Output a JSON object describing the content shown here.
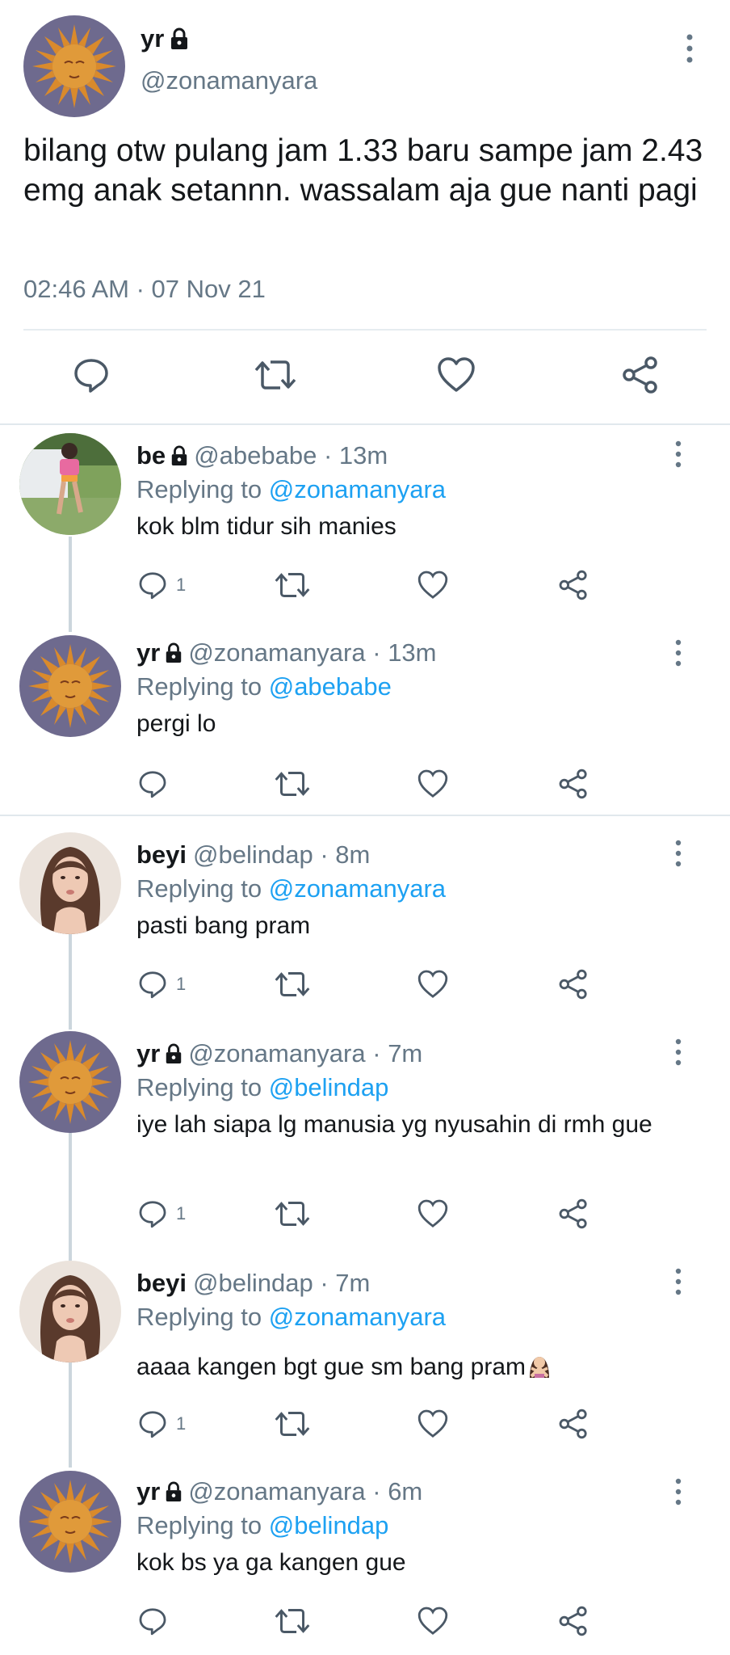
{
  "colors": {
    "accent": "#1da1f2",
    "text": "#14171a",
    "secondary": "#657786",
    "icon": "#4a5866",
    "divider": "#e1e8ed"
  },
  "main_tweet": {
    "name": "yr",
    "handle": "@zonamanyara",
    "text": "bilang otw pulang jam 1.33 baru sampe jam 2.43 emg anak setannn. wassalam aja gue nanti pagi",
    "timestamp": "02:46 AM · 07 Nov 21",
    "avatar": "sun-avatar",
    "locked": true
  },
  "replies": [
    {
      "name": "be",
      "locked": true,
      "handle": "@abebabe",
      "time": "13m",
      "replying_prefix": "Replying to ",
      "replying_to": "@zonamanyara",
      "text": "kok blm tidur sih manies",
      "reply_count": "1",
      "avatar": "photo-avatar-pink-shirt"
    },
    {
      "name": "yr",
      "locked": true,
      "handle": "@zonamanyara",
      "time": "13m",
      "replying_prefix": "Replying to ",
      "replying_to": "@abebabe",
      "text": "pergi lo",
      "reply_count": "",
      "avatar": "sun-avatar"
    },
    {
      "name": "beyi",
      "locked": false,
      "handle": "@belindap",
      "time": "8m",
      "replying_prefix": "Replying to ",
      "replying_to": "@zonamanyara",
      "text": "pasti bang pram",
      "reply_count": "1",
      "avatar": "photo-avatar-woman"
    },
    {
      "name": "yr",
      "locked": true,
      "handle": "@zonamanyara",
      "time": "7m",
      "replying_prefix": "Replying to ",
      "replying_to": "@belindap",
      "text": "iye lah siapa lg manusia yg nyusahin di rmh gue",
      "reply_count": "1",
      "avatar": "sun-avatar"
    },
    {
      "name": "beyi",
      "locked": false,
      "handle": "@belindap",
      "time": "7m",
      "replying_prefix": "Replying to ",
      "replying_to": "@zonamanyara",
      "text": "aaaa kangen bgt gue sm bang pram",
      "reply_count": "1",
      "avatar": "photo-avatar-woman",
      "emoji": "person-gesturing-no-emoji"
    },
    {
      "name": "yr",
      "locked": true,
      "handle": "@zonamanyara",
      "time": "6m",
      "replying_prefix": "Replying to ",
      "replying_to": "@belindap",
      "text": "kok bs ya ga kangen gue",
      "reply_count": "",
      "avatar": "sun-avatar"
    }
  ],
  "separator": " · "
}
